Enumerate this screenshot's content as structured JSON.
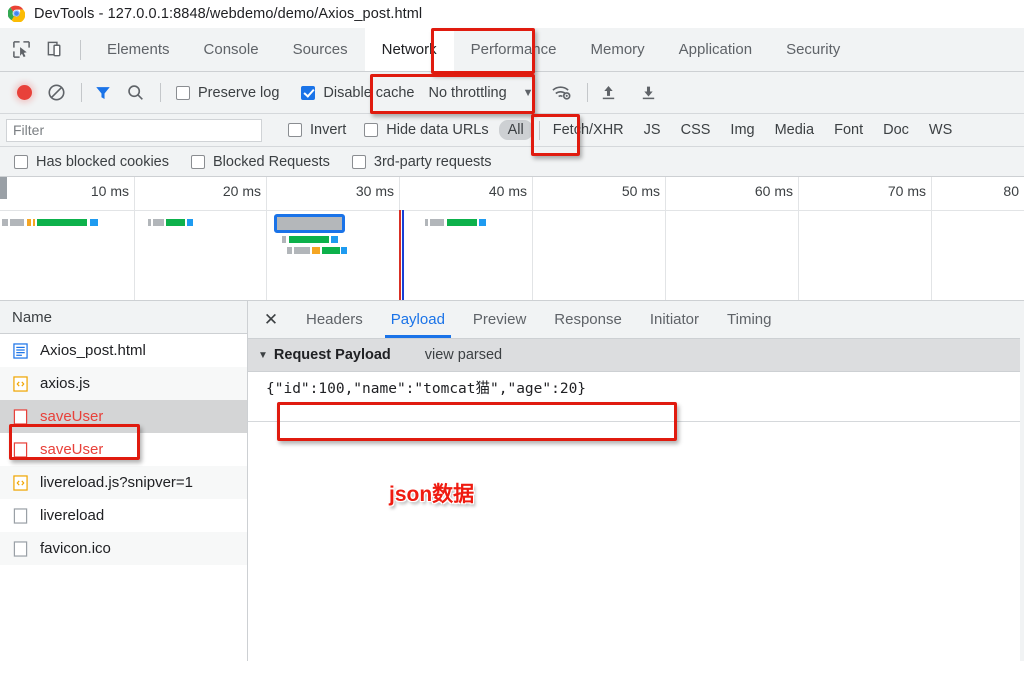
{
  "window": {
    "title": "DevTools - 127.0.0.1:8848/webdemo/demo/Axios_post.html",
    "logo_icon": "chrome-logo-icon"
  },
  "toolbar": {
    "inspect_icon": "inspect-element-icon",
    "device_icon": "device-toolbar-icon",
    "tabs": [
      {
        "label": "Elements",
        "active": false
      },
      {
        "label": "Console",
        "active": false
      },
      {
        "label": "Sources",
        "active": false
      },
      {
        "label": "Network",
        "active": true
      },
      {
        "label": "Performance",
        "active": false
      },
      {
        "label": "Memory",
        "active": false
      },
      {
        "label": "Application",
        "active": false
      },
      {
        "label": "Security",
        "active": false
      }
    ]
  },
  "controls": {
    "record_icon": "record-button-icon",
    "clear_icon": "clear-network-log-icon",
    "filter_icon": "filter-funnel-icon",
    "search_icon": "search-icon",
    "preserve_log": {
      "label": "Preserve log",
      "checked": false
    },
    "disable_cache": {
      "label": "Disable cache",
      "checked": true
    },
    "throttling": {
      "value": "No throttling",
      "caret_icon": "chevron-down-icon"
    },
    "wifi_icon": "network-conditions-icon",
    "upload_icon": "import-har-icon",
    "download_icon": "export-har-icon"
  },
  "filter_row": {
    "filter_placeholder": "Filter",
    "filter_value": "",
    "invert": {
      "label": "Invert",
      "checked": false
    },
    "hide_data_urls": {
      "label": "Hide data URLs",
      "checked": false
    },
    "types": [
      {
        "label": "All",
        "selected": true
      },
      {
        "label": "Fetch/XHR",
        "selected": false
      },
      {
        "label": "JS",
        "selected": false
      },
      {
        "label": "CSS",
        "selected": false
      },
      {
        "label": "Img",
        "selected": false
      },
      {
        "label": "Media",
        "selected": false
      },
      {
        "label": "Font",
        "selected": false
      },
      {
        "label": "Doc",
        "selected": false
      },
      {
        "label": "WS",
        "selected": false
      }
    ]
  },
  "checkbox_row": [
    {
      "label": "Has blocked cookies",
      "checked": false
    },
    {
      "label": "Blocked Requests",
      "checked": false
    },
    {
      "label": "3rd-party requests",
      "checked": false
    }
  ],
  "overview": {
    "ticks": [
      "10 ms",
      "20 ms",
      "30 ms",
      "40 ms",
      "50 ms",
      "60 ms",
      "70 ms",
      "80"
    ]
  },
  "requests": {
    "column_header": "Name",
    "rows": [
      {
        "name": "Axios_post.html",
        "icon": "document-icon",
        "error": false,
        "selected": false
      },
      {
        "name": "axios.js",
        "icon": "script-icon",
        "error": false,
        "selected": false
      },
      {
        "name": "saveUser",
        "icon": "generic-file-icon",
        "error": true,
        "selected": true
      },
      {
        "name": "saveUser",
        "icon": "generic-file-icon",
        "error": true,
        "selected": false
      },
      {
        "name": "livereload.js?snipver=1",
        "icon": "script-icon",
        "error": false,
        "selected": false
      },
      {
        "name": "livereload",
        "icon": "generic-file-icon",
        "error": false,
        "selected": false
      },
      {
        "name": "favicon.ico",
        "icon": "generic-file-icon",
        "error": false,
        "selected": false
      }
    ]
  },
  "detail": {
    "close_icon": "close-icon",
    "tabs": [
      {
        "label": "Headers",
        "active": false
      },
      {
        "label": "Payload",
        "active": true
      },
      {
        "label": "Preview",
        "active": false
      },
      {
        "label": "Response",
        "active": false
      },
      {
        "label": "Initiator",
        "active": false
      },
      {
        "label": "Timing",
        "active": false
      }
    ],
    "section_title": "Request Payload",
    "view_parsed": "view parsed",
    "payload_text": "{\"id\":100,\"name\":\"tomcat猫\",\"age\":20}"
  },
  "annotations": {
    "note_text": "json数据",
    "color": "#e01b0f"
  }
}
